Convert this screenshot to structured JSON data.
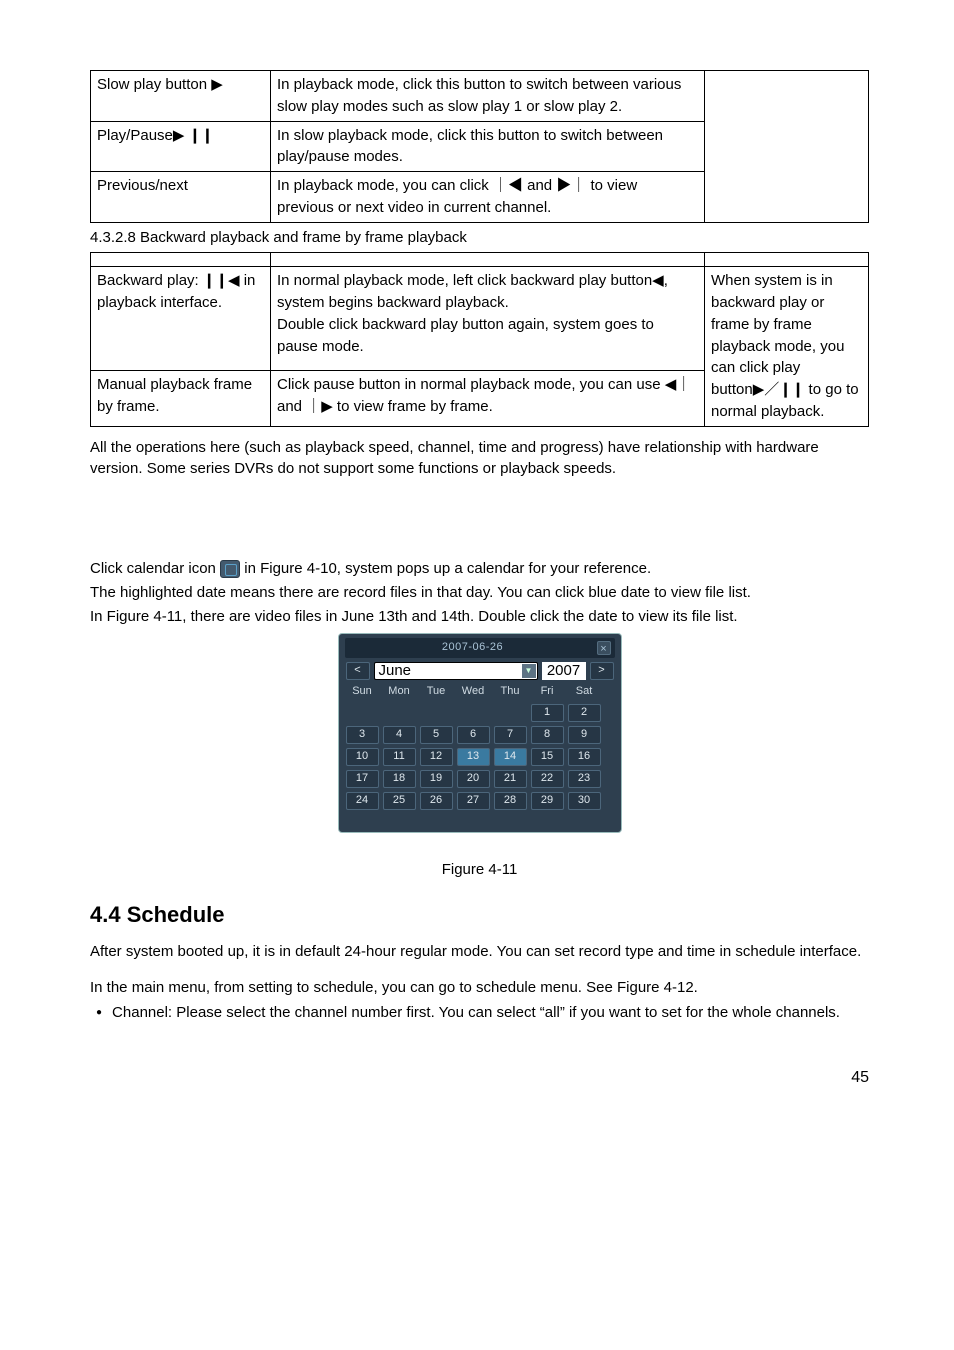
{
  "table1": {
    "r1c1": "Slow play button  ▶",
    "r1c2": "In playback mode, click this button to switch between various slow play modes such as slow play 1 or slow play 2.",
    "r2c1": "Play/Pause▶       ❙❙",
    "r2c2": "In slow playback mode, click this button to switch between play/pause modes.",
    "r3c1": "Previous/next",
    "r3c2": "In playback mode, you can click ｜◀ and  ▶｜ to view previous or next video in current channel."
  },
  "sect_num": "4.3.2.8  Backward playback and frame by frame playback",
  "table2": {
    "r1c1": "Backward play: ❙❙◀ in playback interface.",
    "r1c2": "In normal playback mode, left click backward play button◀, system begins backward playback.\nDouble click backward play button again, system goes to pause mode.",
    "r1c3_a": "When system is in backward play or frame by frame playback mode, you can click play",
    "r2c1": "Manual playback frame by frame.",
    "r2c2": "Click pause button in normal playback mode, you can use ◀｜ and ｜▶ to view frame by frame.",
    "r2c3": "button▶／❙❙ to go to normal playback."
  },
  "para1": "All the operations here (such as playback speed, channel, time and progress) have relationship with hardware version. Some series DVRs do not support some functions or playback speeds.",
  "line_cal_1a": "Click calendar icon",
  "line_cal_1b": " in Figure 4-10, system pops up a calendar for your reference.",
  "line_cal_2": "The highlighted date means there are record files in that day. You can click blue date to view file list.",
  "line_cal_3": "In Figure 4-11, there are video files in June 13th and 14th. Double click the date to view its file list.",
  "calendar": {
    "title": "2007-06-26",
    "lt": "<",
    "gt": ">",
    "month": "June",
    "year": "2007",
    "days": [
      "Sun",
      "Mon",
      "Tue",
      "Wed",
      "Thu",
      "Fri",
      "Sat"
    ],
    "rows": [
      [
        "",
        "",
        "",
        "",
        "",
        "1",
        "2"
      ],
      [
        "3",
        "4",
        "5",
        "6",
        "7",
        "8",
        "9"
      ],
      [
        "10",
        "11",
        "12",
        "13",
        "14",
        "15",
        "16"
      ],
      [
        "17",
        "18",
        "19",
        "20",
        "21",
        "22",
        "23"
      ],
      [
        "24",
        "25",
        "26",
        "27",
        "28",
        "29",
        "30"
      ]
    ],
    "highlight": [
      "13",
      "14"
    ]
  },
  "figure_caption": "Figure 4-11",
  "schedule_heading": "4.4  Schedule",
  "schedule_p1": "After system booted up, it is in default 24-hour regular mode. You can set record type and time in schedule interface.",
  "schedule_p2": "In the main menu, from setting to schedule, you can go to schedule menu. See Figure 4-12.",
  "schedule_bullet": "Channel: Please select the channel number first. You can select “all” if you want to set for the whole channels.",
  "page_number": "45"
}
